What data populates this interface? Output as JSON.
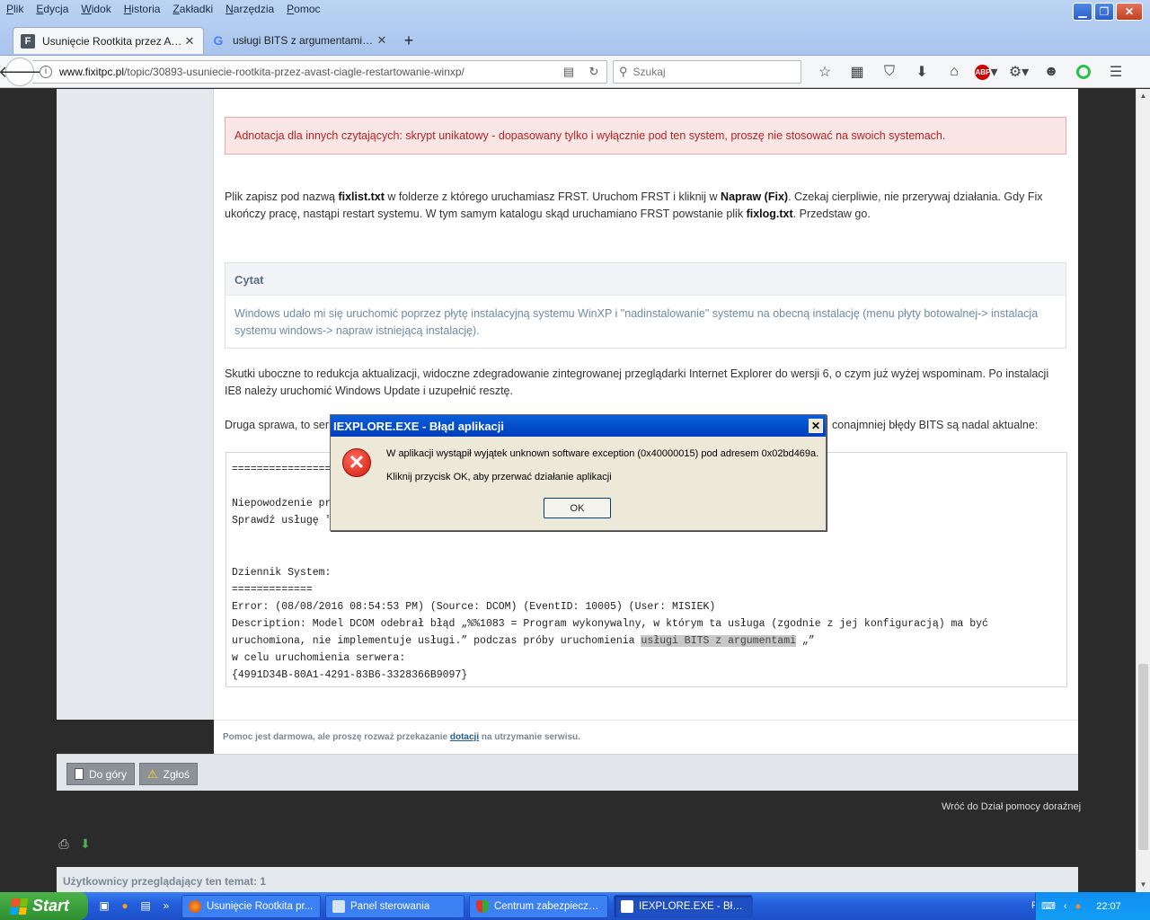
{
  "browser": {
    "menu": [
      "Plik",
      "Edycja",
      "Widok",
      "Historia",
      "Zakładki",
      "Narzędzia",
      "Pomoc"
    ],
    "tabs": [
      {
        "title": "Usunięcie Rootkita przez Avast..."
      },
      {
        "title": "usługi BITS z argumentami - S..."
      }
    ],
    "url_domain": "www.fixitpc.pl",
    "url_path": "/topic/30893-usuniecie-rootkita-przez-avast-ciagle-restartowanie-winxp/",
    "search_placeholder": "Szukaj",
    "abp_label": "ABP",
    "icons": [
      "star-icon",
      "reading-list-icon",
      "pocket-icon",
      "download-icon",
      "home-icon",
      "adblock-icon",
      "addon-icon",
      "emoji-icon",
      "grammarly-icon",
      "menu-icon"
    ]
  },
  "post": {
    "note": "Adnotacja dla innych czytających: skrypt unikatowy - dopasowany tylko i wyłącznie pod ten system, proszę nie stosować na swoich systemach.",
    "p1": {
      "t1": "Plik zapisz pod nazwą ",
      "b1": "fixlist.txt",
      "t2": " w folderze z którego uruchamiasz FRST. Uruchom FRST i kliknij w ",
      "b2": "Napraw (Fix)",
      "t3": ". Czekaj cierpliwie, nie przerywaj działania. Gdy Fix ukończy pracę, nastąpi restart systemu. W tym samym katalogu skąd uruchamiano FRST powstanie plik ",
      "b3": "fixlog.txt",
      "t4": ". Przedstaw go."
    },
    "quote_header": "Cytat",
    "quote_body": "Windows udało mi się uruchomić poprzez płytę instalacyjną systemu WinXP i \"nadinstalowanie\" systemu na obecną instalację (menu płyty botowalnej-> instalacja systemu windows-> napraw istniejącą instalację).",
    "p2": "Skutki uboczne to redukcja aktualizacji, widoczne zdegradowanie zintegrowanej przeglądarki Internet Explorer do wersji 6, o czym już wyżej wspominam. Po instalacji IE8 należy uruchomić Windows Update i uzupełnić resztę.",
    "p3_left": "Druga sprawa, to seri",
    "p3_right": "conajmniej błędy BITS są nadal aktualne:",
    "code_lines": [
      "=================",
      "",
      "Niepowodzenie pr",
      "Sprawdź usługę '",
      "",
      "",
      "Dziennik System:",
      "=============",
      "Error: (08/08/2016 08:54:53 PM) (Source: DCOM) (EventID: 10005) (User: MISIEK)",
      "Description: Model DCOM odebrał błąd „%%1083 = Program wykonywalny, w którym ta usługa (zgodnie z jej konfiguracją) ma być",
      "uruchomiona, nie implementuje usługi.” podczas próby uruchomienia ",
      "w celu uruchomienia serwera:",
      "{4991D34B-80A1-4291-83B6-3328366B9097}"
    ],
    "code_highlight": "usługi BITS z argumentami",
    "code_tail": " „”",
    "signature_pre": "Pomoc jest darmowa, ale proszę rozważ przekazanie ",
    "signature_link": "dotacji",
    "signature_post": " na utrzymanie serwisu.",
    "btn_top": "Do góry",
    "btn_report": "Zgłoś"
  },
  "page": {
    "back_link": "Wróć do Dział pomocy doraźnej",
    "viewers": "Użytkownicy przeglądający ten temat: 1"
  },
  "dialog": {
    "title": "IEXPLORE.EXE - Błąd aplikacji",
    "message1": "W aplikacji wystąpił wyjątek unknown software exception (0x40000015) pod adresem 0x02bd469a.",
    "message2": "Kliknij przycisk OK, aby przerwać działanie aplikacji",
    "ok": "OK"
  },
  "taskbar": {
    "start": "Start",
    "buttons": [
      {
        "label": "Usunięcie Rootkita pr..."
      },
      {
        "label": "Panel sterowania"
      },
      {
        "label": "Centrum zabezpiecze..."
      },
      {
        "label": "IEXPLORE.EXE - Błąd ..."
      }
    ],
    "lang": "PL",
    "clock": "22:07"
  }
}
